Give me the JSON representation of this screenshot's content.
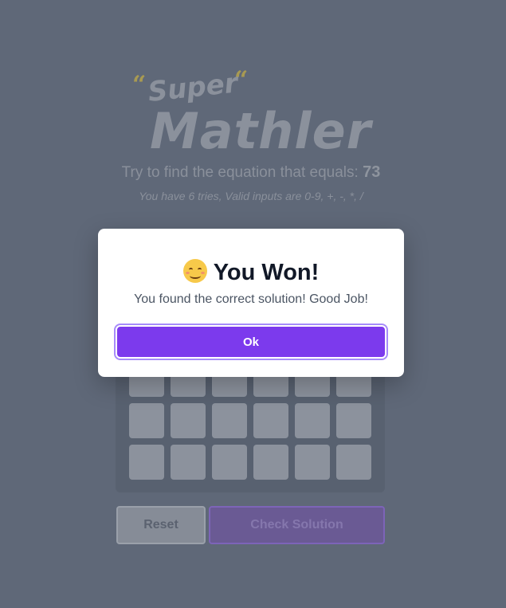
{
  "logo": {
    "open_quote": "“",
    "close_quote": "“",
    "word_top": "Super",
    "word_main": "Mathler"
  },
  "header": {
    "prompt_prefix": "Try to find the equation that equals: ",
    "target_value": "73",
    "hint": "You have 6 tries, Valid inputs are 0-9, +, -, *, /"
  },
  "board": {
    "rows": 3,
    "cols": 6
  },
  "controls": {
    "reset_label": "Reset",
    "check_label": "Check Solution"
  },
  "modal": {
    "icon": "smiling-face-icon",
    "title": "You Won!",
    "message": "You found the correct solution! Good Job!",
    "ok_label": "Ok"
  },
  "colors": {
    "overlay_background": "#5f6878",
    "accent": "#7c3aed",
    "modal_background": "#ffffff",
    "title_text": "#111827"
  }
}
